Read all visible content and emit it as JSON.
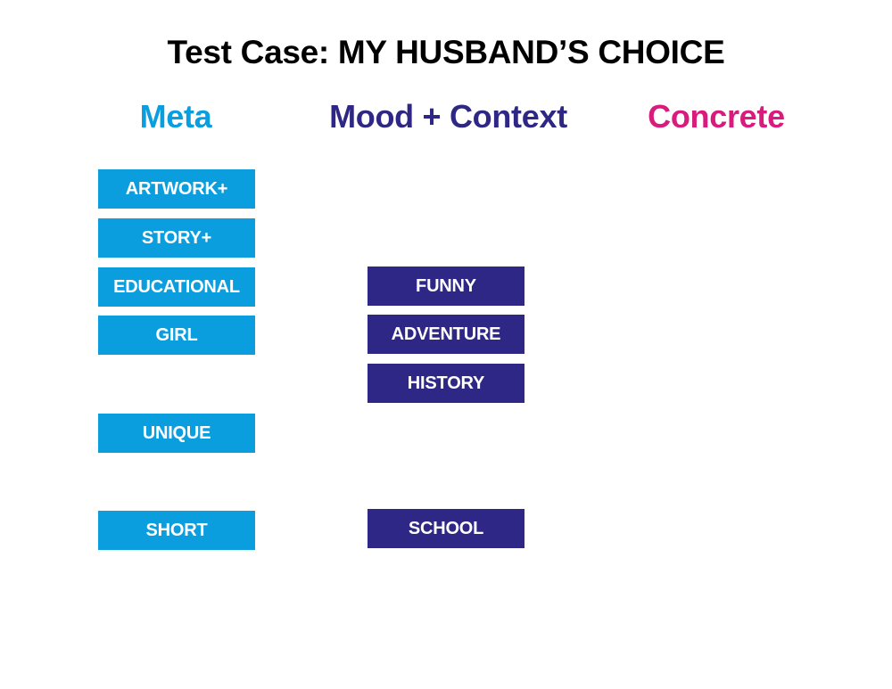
{
  "title": "Test Case: MY HUSBAND’S CHOICE",
  "colors": {
    "meta": "#0b9ede",
    "mood": "#2e2785",
    "concrete": "#d81b7c"
  },
  "columns": {
    "meta": "Meta",
    "mood": "Mood + Context",
    "concrete": "Concrete"
  },
  "meta_tags": [
    "ARTWORK+",
    "STORY+",
    "EDUCATIONAL",
    "GIRL",
    "UNIQUE",
    "SHORT"
  ],
  "mood_tags": [
    "FUNNY",
    "ADVENTURE",
    "HISTORY",
    "SCHOOL"
  ]
}
